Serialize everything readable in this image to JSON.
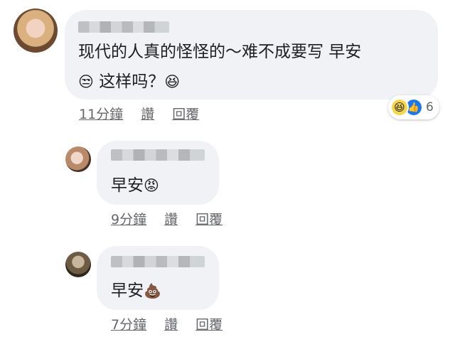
{
  "comments": [
    {
      "line1": "现代的人真的怪怪的～难不成要写 早安",
      "line2_emoji_a": "😒",
      "line2_text": " 这样吗？",
      "line2_emoji_b": "😆",
      "time": "11分鐘",
      "like": "讚",
      "reply": "回覆",
      "reactions": {
        "icons": [
          "haha-icon",
          "like-icon"
        ],
        "count": "6"
      }
    },
    {
      "text": "早安",
      "emoji": "😡",
      "time": "9分鐘",
      "like": "讚",
      "reply": "回覆"
    },
    {
      "text": "早安",
      "emoji": "💩",
      "time": "7分鐘",
      "like": "讚",
      "reply": "回覆"
    }
  ]
}
